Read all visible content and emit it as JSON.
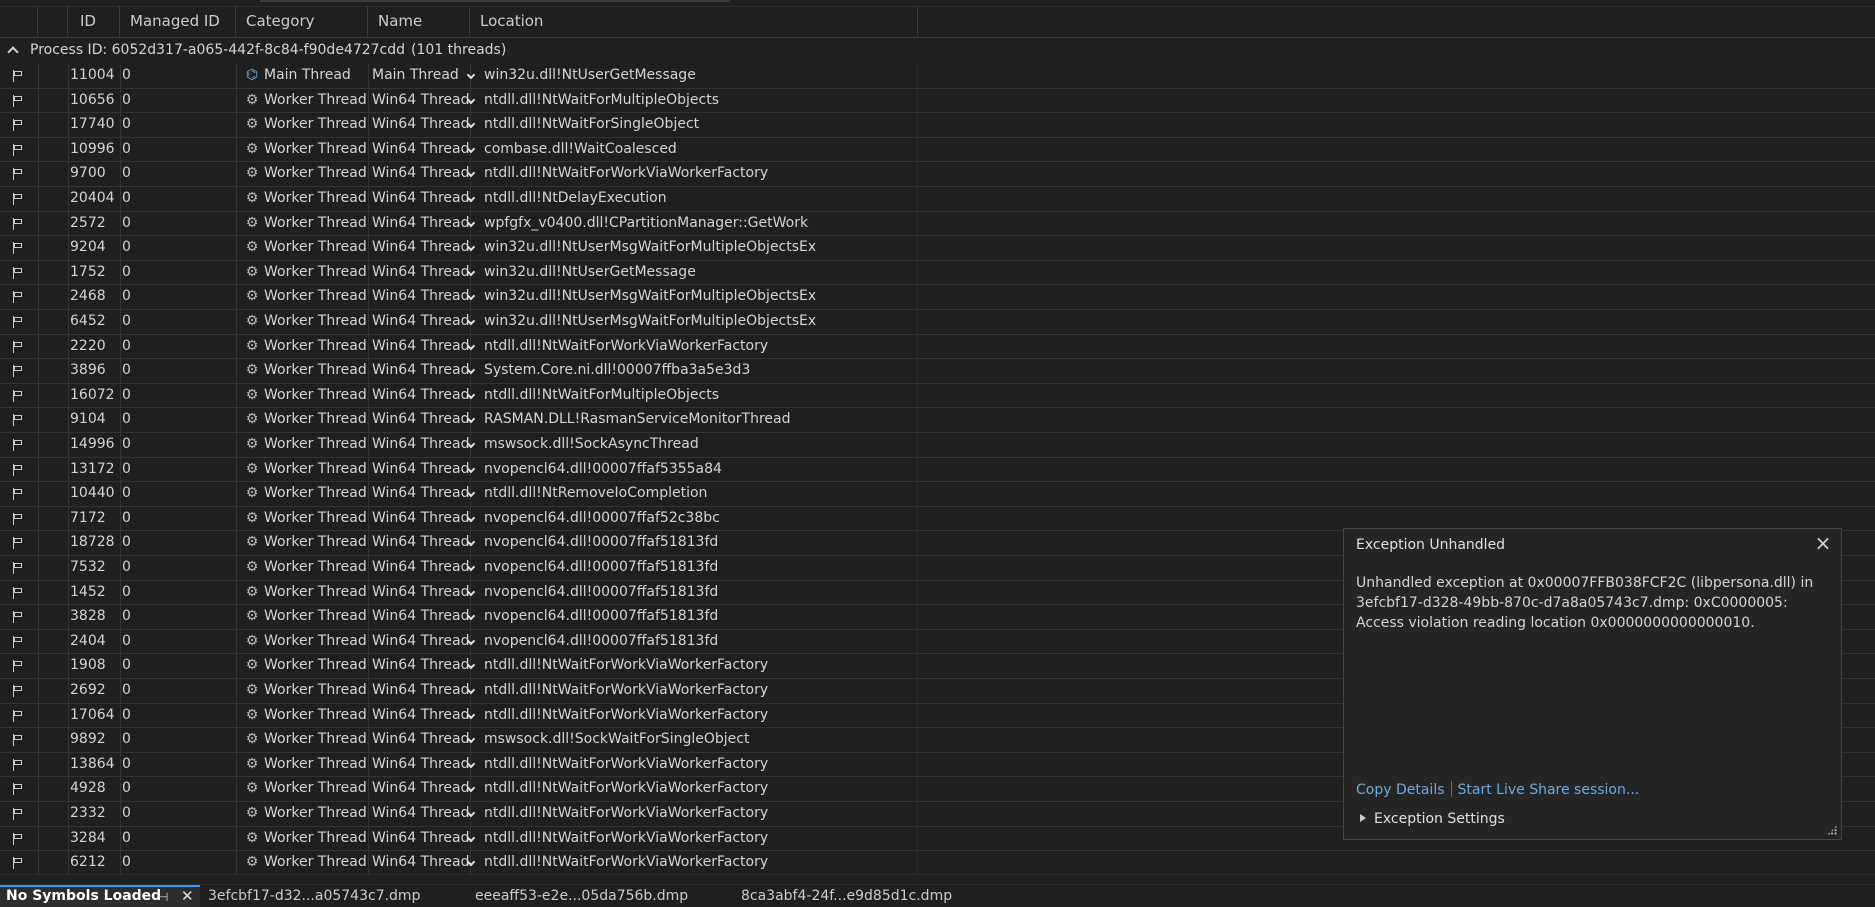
{
  "columns": {
    "id": "ID",
    "managed_id": "Managed ID",
    "category": "Category",
    "name": "Name",
    "location": "Location"
  },
  "group": {
    "label": "Process ID: 6052d317-a065-442f-8c84-f90de4727cdd",
    "count": "(101 threads)"
  },
  "threads": [
    {
      "id": "11004",
      "managed_id": "0",
      "category": "Main Thread",
      "name": "Main Thread",
      "location": "win32u.dll!NtUserGetMessage",
      "main": true
    },
    {
      "id": "10656",
      "managed_id": "0",
      "category": "Worker Thread",
      "name": "Win64 Thread",
      "location": "ntdll.dll!NtWaitForMultipleObjects"
    },
    {
      "id": "17740",
      "managed_id": "0",
      "category": "Worker Thread",
      "name": "Win64 Thread",
      "location": "ntdll.dll!NtWaitForSingleObject"
    },
    {
      "id": "10996",
      "managed_id": "0",
      "category": "Worker Thread",
      "name": "Win64 Thread",
      "location": "combase.dll!WaitCoalesced"
    },
    {
      "id": "9700",
      "managed_id": "0",
      "category": "Worker Thread",
      "name": "Win64 Thread",
      "location": "ntdll.dll!NtWaitForWorkViaWorkerFactory"
    },
    {
      "id": "20404",
      "managed_id": "0",
      "category": "Worker Thread",
      "name": "Win64 Thread",
      "location": "ntdll.dll!NtDelayExecution"
    },
    {
      "id": "2572",
      "managed_id": "0",
      "category": "Worker Thread",
      "name": "Win64 Thread",
      "location": "wpfgfx_v0400.dll!CPartitionManager::GetWork"
    },
    {
      "id": "9204",
      "managed_id": "0",
      "category": "Worker Thread",
      "name": "Win64 Thread",
      "location": "win32u.dll!NtUserMsgWaitForMultipleObjectsEx"
    },
    {
      "id": "1752",
      "managed_id": "0",
      "category": "Worker Thread",
      "name": "Win64 Thread",
      "location": "win32u.dll!NtUserGetMessage"
    },
    {
      "id": "2468",
      "managed_id": "0",
      "category": "Worker Thread",
      "name": "Win64 Thread",
      "location": "win32u.dll!NtUserMsgWaitForMultipleObjectsEx"
    },
    {
      "id": "6452",
      "managed_id": "0",
      "category": "Worker Thread",
      "name": "Win64 Thread",
      "location": "win32u.dll!NtUserMsgWaitForMultipleObjectsEx"
    },
    {
      "id": "2220",
      "managed_id": "0",
      "category": "Worker Thread",
      "name": "Win64 Thread",
      "location": "ntdll.dll!NtWaitForWorkViaWorkerFactory"
    },
    {
      "id": "3896",
      "managed_id": "0",
      "category": "Worker Thread",
      "name": "Win64 Thread",
      "location": "System.Core.ni.dll!00007ffba3a5e3d3"
    },
    {
      "id": "16072",
      "managed_id": "0",
      "category": "Worker Thread",
      "name": "Win64 Thread",
      "location": "ntdll.dll!NtWaitForMultipleObjects"
    },
    {
      "id": "9104",
      "managed_id": "0",
      "category": "Worker Thread",
      "name": "Win64 Thread",
      "location": "RASMAN.DLL!RasmanServiceMonitorThread"
    },
    {
      "id": "14996",
      "managed_id": "0",
      "category": "Worker Thread",
      "name": "Win64 Thread",
      "location": "mswsock.dll!SockAsyncThread"
    },
    {
      "id": "13172",
      "managed_id": "0",
      "category": "Worker Thread",
      "name": "Win64 Thread",
      "location": "nvopencl64.dll!00007ffaf5355a84"
    },
    {
      "id": "10440",
      "managed_id": "0",
      "category": "Worker Thread",
      "name": "Win64 Thread",
      "location": "ntdll.dll!NtRemoveIoCompletion"
    },
    {
      "id": "7172",
      "managed_id": "0",
      "category": "Worker Thread",
      "name": "Win64 Thread",
      "location": "nvopencl64.dll!00007ffaf52c38bc"
    },
    {
      "id": "18728",
      "managed_id": "0",
      "category": "Worker Thread",
      "name": "Win64 Thread",
      "location": "nvopencl64.dll!00007ffaf51813fd"
    },
    {
      "id": "7532",
      "managed_id": "0",
      "category": "Worker Thread",
      "name": "Win64 Thread",
      "location": "nvopencl64.dll!00007ffaf51813fd"
    },
    {
      "id": "1452",
      "managed_id": "0",
      "category": "Worker Thread",
      "name": "Win64 Thread",
      "location": "nvopencl64.dll!00007ffaf51813fd"
    },
    {
      "id": "3828",
      "managed_id": "0",
      "category": "Worker Thread",
      "name": "Win64 Thread",
      "location": "nvopencl64.dll!00007ffaf51813fd"
    },
    {
      "id": "2404",
      "managed_id": "0",
      "category": "Worker Thread",
      "name": "Win64 Thread",
      "location": "nvopencl64.dll!00007ffaf51813fd"
    },
    {
      "id": "1908",
      "managed_id": "0",
      "category": "Worker Thread",
      "name": "Win64 Thread",
      "location": "ntdll.dll!NtWaitForWorkViaWorkerFactory"
    },
    {
      "id": "2692",
      "managed_id": "0",
      "category": "Worker Thread",
      "name": "Win64 Thread",
      "location": "ntdll.dll!NtWaitForWorkViaWorkerFactory"
    },
    {
      "id": "17064",
      "managed_id": "0",
      "category": "Worker Thread",
      "name": "Win64 Thread",
      "location": "ntdll.dll!NtWaitForWorkViaWorkerFactory"
    },
    {
      "id": "9892",
      "managed_id": "0",
      "category": "Worker Thread",
      "name": "Win64 Thread",
      "location": "mswsock.dll!SockWaitForSingleObject"
    },
    {
      "id": "13864",
      "managed_id": "0",
      "category": "Worker Thread",
      "name": "Win64 Thread",
      "location": "ntdll.dll!NtWaitForWorkViaWorkerFactory"
    },
    {
      "id": "4928",
      "managed_id": "0",
      "category": "Worker Thread",
      "name": "Win64 Thread",
      "location": "ntdll.dll!NtWaitForWorkViaWorkerFactory"
    },
    {
      "id": "2332",
      "managed_id": "0",
      "category": "Worker Thread",
      "name": "Win64 Thread",
      "location": "ntdll.dll!NtWaitForWorkViaWorkerFactory"
    },
    {
      "id": "3284",
      "managed_id": "0",
      "category": "Worker Thread",
      "name": "Win64 Thread",
      "location": "ntdll.dll!NtWaitForWorkViaWorkerFactory"
    },
    {
      "id": "6212",
      "managed_id": "0",
      "category": "Worker Thread",
      "name": "Win64 Thread",
      "location": "ntdll.dll!NtWaitForWorkViaWorkerFactory"
    }
  ],
  "exception": {
    "title": "Exception Unhandled",
    "message": "Unhandled exception at 0x00007FFB038FCF2C (libpersona.dll) in 3efcbf17-d328-49bb-870c-d7a8a05743c7.dmp: 0xC0000005: Access violation reading location 0x0000000000000010.",
    "copy_details": "Copy Details",
    "live_share": "Start Live Share session...",
    "settings": "Exception Settings"
  },
  "tabs": {
    "active": "No Symbols Loaded",
    "t2": "3efcbf17-d32...a05743c7.dmp",
    "t3": "eeeaff53-e2e...05da756b.dmp",
    "t4": "8ca3abf4-24f...e9d85d1c.dmp"
  },
  "colors": {
    "accent": "#3794ff",
    "link": "#6fa8dc",
    "background": "#1f1f1f"
  }
}
